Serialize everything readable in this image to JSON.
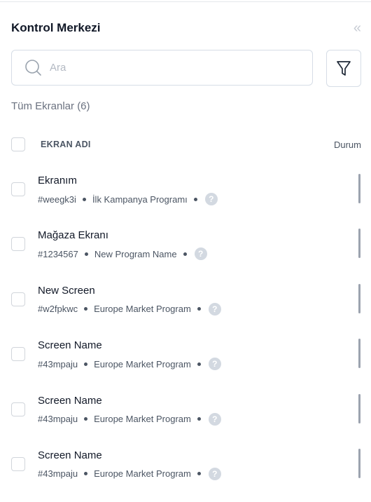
{
  "panel": {
    "title": "Kontrol Merkezi",
    "collapse_icon": "chevrons-left-icon"
  },
  "search": {
    "placeholder": "Ara",
    "value": ""
  },
  "filter": {
    "icon": "filter-icon"
  },
  "section": {
    "label": "Tüm Ekranlar (6)"
  },
  "table": {
    "col_name": "EKRAN ADI",
    "col_status": "Durum"
  },
  "screens": [
    {
      "name": "Ekranım",
      "code": "#weegk3i",
      "program": "İlk Kampanya Programı"
    },
    {
      "name": "Mağaza Ekranı",
      "code": "#1234567",
      "program": "New Program Name"
    },
    {
      "name": "New Screen",
      "code": "#w2fpkwc",
      "program": "Europe Market Program"
    },
    {
      "name": "Screen Name",
      "code": "#43mpaju",
      "program": "Europe Market Program"
    },
    {
      "name": "Screen Name",
      "code": "#43mpaju",
      "program": "Europe Market Program"
    },
    {
      "name": "Screen Name",
      "code": "#43mpaju",
      "program": "Europe Market Program"
    }
  ],
  "colors": {
    "border": "#d6dde6",
    "muted": "#6b7280",
    "help_icon_bg": "#d3d9e1",
    "status_bar": "#9ca3af"
  }
}
